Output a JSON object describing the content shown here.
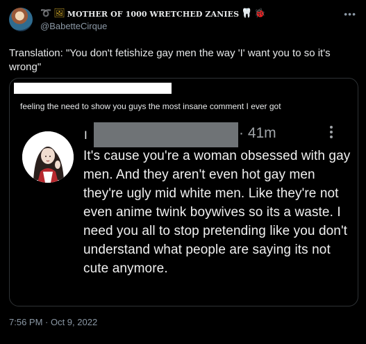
{
  "author": {
    "display_name": "MOTHER OF 1000 WRETCHED ZANIES",
    "handle": "@BabetteCirque",
    "name_emojis_before": [
      "➰",
      "🖼"
    ],
    "name_emojis_after": [
      "🦷",
      "🐞"
    ]
  },
  "tweet": {
    "text": "Translation: \"You don't fetishize gay men the way 'I' want you to so it's wrong\"",
    "timestamp": "7:56 PM · Oct 9, 2022",
    "more_icon": "•••"
  },
  "quoted_screenshot": {
    "caption": "feeling the need to show you guys the most insane comment I ever got",
    "comment": {
      "name_initial": "I",
      "time": "· 41m",
      "text": "It's cause you're a woman obsessed with gay men. And they aren't even hot gay men they're ugly mid white men. Like they're not even anime twink boywives so its a waste. I need you all to stop pretending like you don't understand what people are saying its not cute anymore."
    }
  },
  "colors": {
    "background": "#000000",
    "text_primary": "#e7e9ea",
    "text_secondary": "#8b98a5",
    "border": "#2f3336",
    "redaction_white": "#ffffff",
    "redaction_gray": "#6f7376"
  }
}
